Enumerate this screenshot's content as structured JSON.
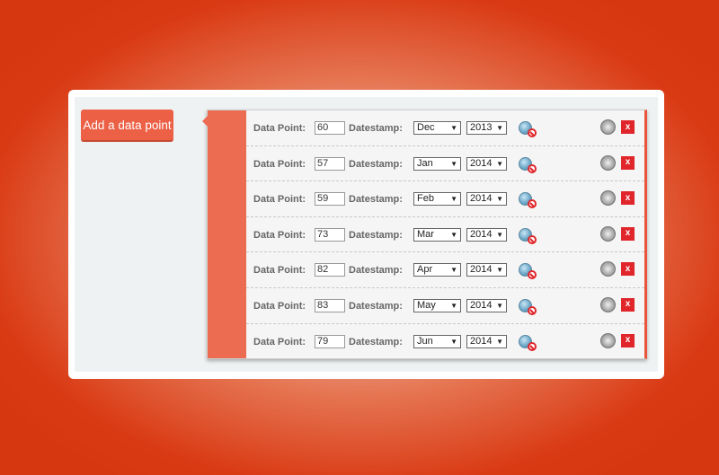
{
  "add_button_label": "Add a data point",
  "labels": {
    "data_point": "Data Point:",
    "datestamp": "Datestamp:"
  },
  "colors": {
    "accent": "#ec6046",
    "delete": "#e0262b",
    "background": "#d93a14"
  },
  "icons": {
    "row_status": "globe-blocked-icon",
    "row_globe": "globe-icon",
    "delete": "delete-icon"
  },
  "rows": [
    {
      "value": "60",
      "month": "Dec",
      "year": "2013",
      "delete_label": "x"
    },
    {
      "value": "57",
      "month": "Jan",
      "year": "2014",
      "delete_label": "x"
    },
    {
      "value": "59",
      "month": "Feb",
      "year": "2014",
      "delete_label": "x"
    },
    {
      "value": "73",
      "month": "Mar",
      "year": "2014",
      "delete_label": "x"
    },
    {
      "value": "82",
      "month": "Apr",
      "year": "2014",
      "delete_label": "x"
    },
    {
      "value": "83",
      "month": "May",
      "year": "2014",
      "delete_label": "x"
    },
    {
      "value": "79",
      "month": "Jun",
      "year": "2014",
      "delete_label": "x"
    }
  ]
}
